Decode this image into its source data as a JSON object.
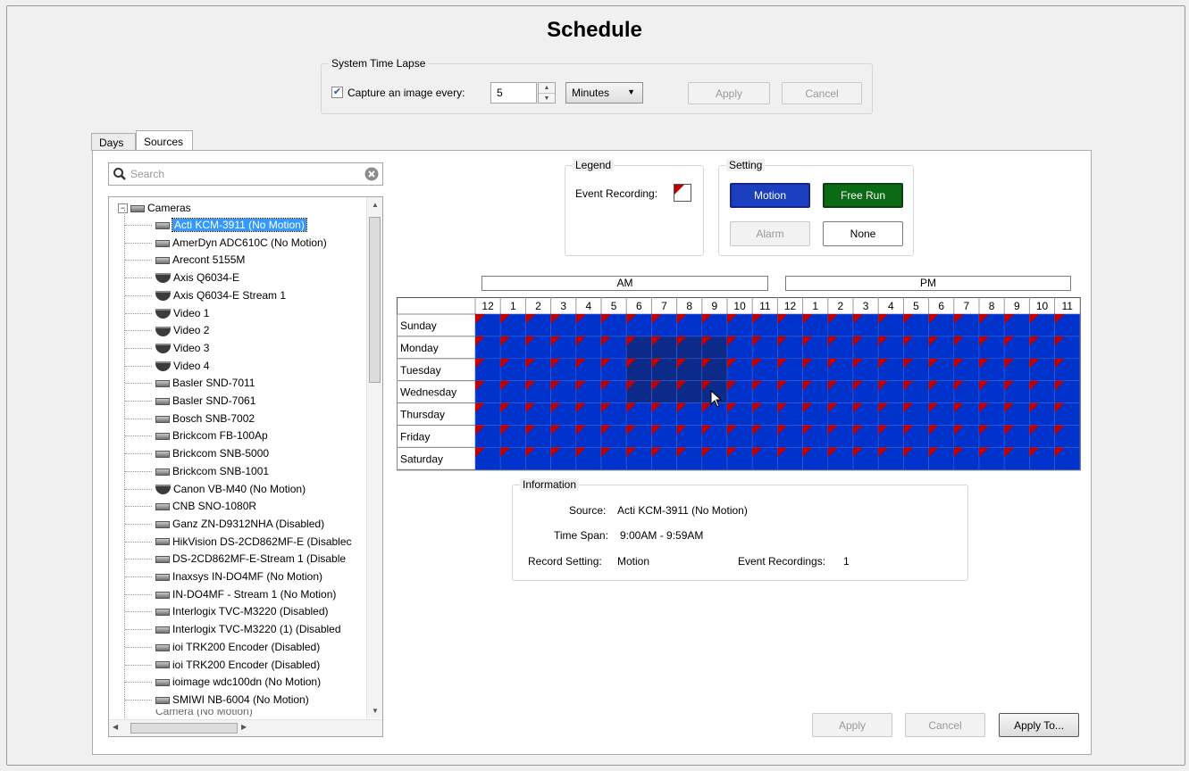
{
  "title": "Schedule",
  "time_lapse": {
    "group_label": "System Time Lapse",
    "checkbox_label": "Capture an image every:",
    "checked": true,
    "value": "5",
    "unit": "Minutes",
    "apply_label": "Apply",
    "cancel_label": "Cancel"
  },
  "tabs": [
    "Days",
    "Sources"
  ],
  "active_tab": "Sources",
  "search": {
    "placeholder": "Search"
  },
  "tree": {
    "root_label": "Cameras",
    "selected": "Acti KCM-3911 (No Motion)",
    "items": [
      {
        "label": "Acti KCM-3911 (No Motion)",
        "icon": "box-camera-icon"
      },
      {
        "label": "AmerDyn ADC610C (No Motion)",
        "icon": "box-camera-icon"
      },
      {
        "label": "Arecont 5155M",
        "icon": "box-camera-icon"
      },
      {
        "label": "Axis Q6034-E",
        "icon": "dome-camera-icon"
      },
      {
        "label": "Axis Q6034-E Stream 1",
        "icon": "dome-camera-icon"
      },
      {
        "label": "Video 1",
        "icon": "dome-camera-icon"
      },
      {
        "label": "Video 2",
        "icon": "dome-camera-icon"
      },
      {
        "label": "Video 3",
        "icon": "dome-camera-icon"
      },
      {
        "label": "Video 4",
        "icon": "dome-camera-icon"
      },
      {
        "label": "Basler SND-7011",
        "icon": "box-camera-icon"
      },
      {
        "label": "Basler SND-7061",
        "icon": "box-camera-icon"
      },
      {
        "label": "Bosch SNB-7002",
        "icon": "box-camera-icon"
      },
      {
        "label": "Brickcom FB-100Ap",
        "icon": "box-camera-icon"
      },
      {
        "label": "Brickcom SNB-5000",
        "icon": "box-camera-icon"
      },
      {
        "label": "Brickcom SNB-1001",
        "icon": "box-camera-icon"
      },
      {
        "label": "Canon VB-M40 (No Motion)",
        "icon": "dome-camera-icon"
      },
      {
        "label": "CNB SNO-1080R",
        "icon": "box-camera-icon"
      },
      {
        "label": "Ganz ZN-D9312NHA (Disabled)",
        "icon": "box-camera-icon"
      },
      {
        "label": "HikVision DS-2CD862MF-E (Disablec",
        "icon": "box-camera-icon"
      },
      {
        "label": "DS-2CD862MF-E-Stream 1 (Disable",
        "icon": "box-camera-icon"
      },
      {
        "label": "Inaxsys IN-DO4MF (No Motion)",
        "icon": "box-camera-icon"
      },
      {
        "label": "IN-DO4MF - Stream 1 (No Motion)",
        "icon": "box-camera-icon"
      },
      {
        "label": "Interlogix TVC-M3220 (Disabled)",
        "icon": "box-camera-icon"
      },
      {
        "label": "Interlogix TVC-M3220 (1) (Disabled",
        "icon": "box-camera-icon"
      },
      {
        "label": "ioi TRK200 Encoder (Disabled)",
        "icon": "box-camera-icon"
      },
      {
        "label": "ioi TRK200 Encoder (Disabled)",
        "icon": "box-camera-icon"
      },
      {
        "label": "ioimage wdc100dn (No Motion)",
        "icon": "box-camera-icon"
      },
      {
        "label": "SMIWI NB-6004 (No Motion)",
        "icon": "box-camera-icon"
      }
    ]
  },
  "legend": {
    "group_label": "Legend",
    "event_label": "Event Recording:"
  },
  "setting": {
    "group_label": "Setting",
    "motion_label": "Motion",
    "freerun_label": "Free Run",
    "alarm_label": "Alarm",
    "none_label": "None",
    "colors": {
      "motion": "#0033cc",
      "freerun": "#0a6b14",
      "event_marker": "#c00000",
      "selected_cell": "#0b2a8a"
    }
  },
  "schedule": {
    "am_label": "AM",
    "pm_label": "PM",
    "hours": [
      "12",
      "1",
      "2",
      "3",
      "4",
      "5",
      "6",
      "7",
      "8",
      "9",
      "10",
      "11",
      "12",
      "1",
      "2",
      "3",
      "4",
      "5",
      "6",
      "7",
      "8",
      "9",
      "10",
      "11"
    ],
    "days": [
      "Sunday",
      "Monday",
      "Tuesday",
      "Wednesday",
      "Thursday",
      "Friday",
      "Saturday"
    ],
    "selection": {
      "days": [
        "Monday",
        "Tuesday",
        "Wednesday"
      ],
      "hours_from": 6,
      "hours_to": 9
    },
    "fill": "Motion",
    "event_recording_all_cells": true
  },
  "information": {
    "group_label": "Information",
    "source_label": "Source:",
    "source_value": "Acti KCM-3911 (No Motion)",
    "timespan_label": "Time Span:",
    "timespan_value": "9:00AM - 9:59AM",
    "record_label": "Record Setting:",
    "record_value": "Motion",
    "events_label": "Event Recordings:",
    "events_value": "1"
  },
  "footer": {
    "apply_label": "Apply",
    "cancel_label": "Cancel",
    "apply_to_label": "Apply To..."
  }
}
